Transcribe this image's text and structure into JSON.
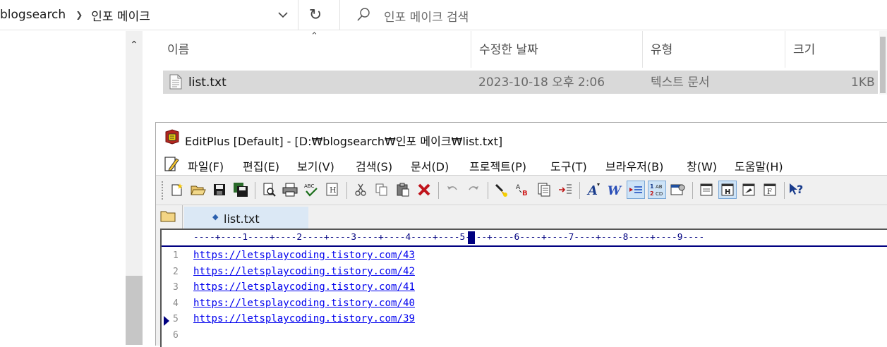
{
  "explorer": {
    "breadcrumb": [
      "blogsearch",
      "인포 메이크"
    ],
    "search_placeholder": "인포 메이크 검색",
    "columns": [
      "이름",
      "수정한 날짜",
      "유형",
      "크기"
    ],
    "files": [
      {
        "name": "list.txt",
        "modified": "2023-10-18 오후 2:06",
        "type": "텍스트 문서",
        "size": "1KB"
      }
    ]
  },
  "editplus": {
    "title": "EditPlus [Default] - [D:₩blogsearch₩인포 메이크₩list.txt]",
    "menu": [
      "파일(F)",
      "편집(E)",
      "보기(V)",
      "검색(S)",
      "문서(D)",
      "프로젝트(P)",
      "도구(T)",
      "브라우저(B)",
      "창(W)",
      "도움말(H)"
    ],
    "tab_label": "list.txt",
    "ruler": "----+----1----+----2----+----3----+----4----+----5----+----6----+----7----+----8----+----9----",
    "lines": [
      {
        "number": "1",
        "text": "https://letsplaycoding.tistory.com/43"
      },
      {
        "number": "2",
        "text": "https://letsplaycoding.tistory.com/42"
      },
      {
        "number": "3",
        "text": "https://letsplaycoding.tistory.com/41"
      },
      {
        "number": "4",
        "text": "https://letsplaycoding.tistory.com/40"
      },
      {
        "number": "5",
        "text": "https://letsplaycoding.tistory.com/39"
      },
      {
        "number": "6",
        "text": ""
      }
    ]
  }
}
